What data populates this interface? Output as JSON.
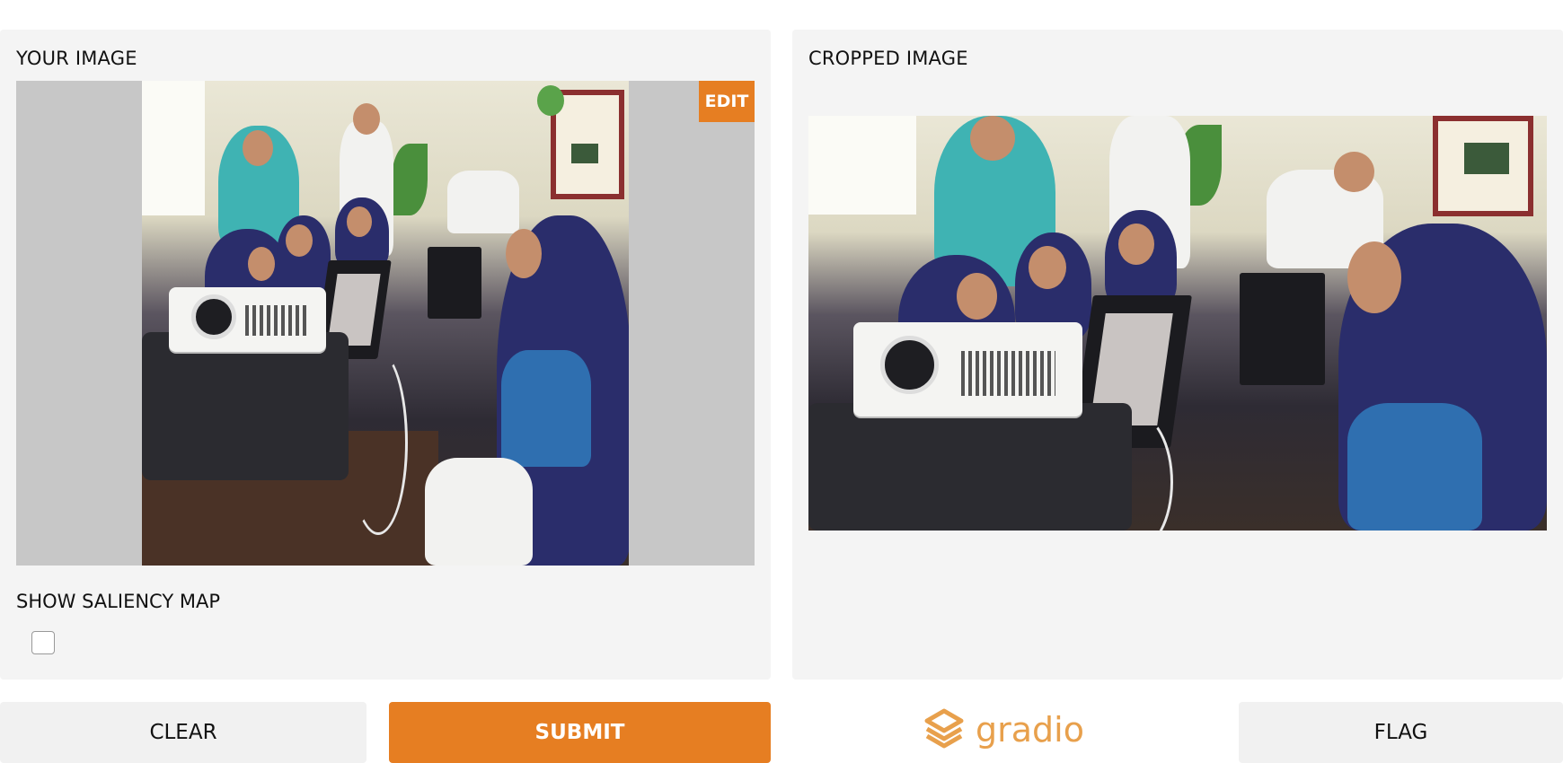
{
  "input_panel": {
    "label": "YOUR IMAGE",
    "edit_label": "EDIT",
    "saliency_label": "SHOW SALIENCY MAP",
    "saliency_checked": false
  },
  "output_panel": {
    "label": "CROPPED IMAGE"
  },
  "actions": {
    "clear_label": "CLEAR",
    "submit_label": "SUBMIT",
    "flag_label": "FLAG"
  },
  "brand": {
    "name": "gradio",
    "icon": "gradio-logo-icon",
    "color": "#e8a04c"
  },
  "colors": {
    "accent": "#e67e22",
    "panel_bg": "#f4f4f4"
  }
}
